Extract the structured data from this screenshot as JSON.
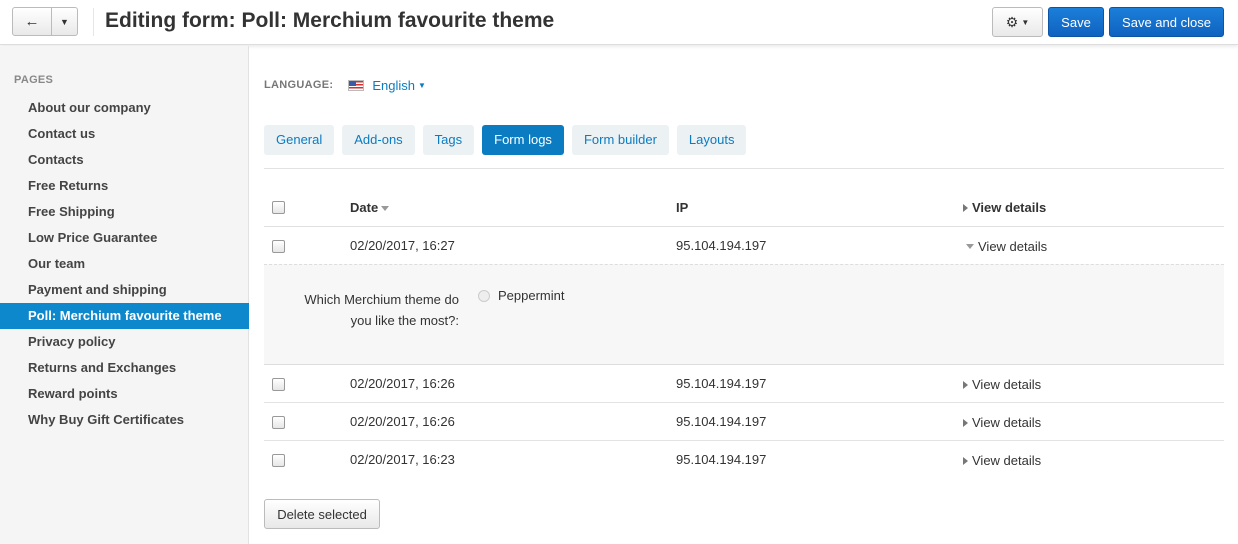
{
  "header": {
    "back_icon": "arrow-left-icon",
    "back_glyph": "←",
    "caret_glyph": "▼",
    "title": "Editing form: Poll: Merchium favourite theme",
    "gear_glyph": "⚙",
    "gear_caret": "▼",
    "save_label": "Save",
    "save_close_label": "Save and close"
  },
  "sidebar": {
    "heading": "PAGES",
    "items": [
      {
        "label": "About our company"
      },
      {
        "label": "Contact us"
      },
      {
        "label": "Contacts"
      },
      {
        "label": "Free Returns"
      },
      {
        "label": "Free Shipping"
      },
      {
        "label": "Low Price Guarantee"
      },
      {
        "label": "Our team"
      },
      {
        "label": "Payment and shipping"
      },
      {
        "label": "Poll: Merchium favourite theme",
        "active": true
      },
      {
        "label": "Privacy policy"
      },
      {
        "label": "Returns and Exchanges"
      },
      {
        "label": "Reward points"
      },
      {
        "label": "Why Buy Gift Certificates"
      }
    ]
  },
  "language": {
    "label": "LANGUAGE:",
    "value": "English",
    "flag_icon": "us-flag-icon"
  },
  "tabs": [
    {
      "label": "General"
    },
    {
      "label": "Add-ons"
    },
    {
      "label": "Tags"
    },
    {
      "label": "Form logs",
      "active": true
    },
    {
      "label": "Form builder"
    },
    {
      "label": "Layouts"
    }
  ],
  "table": {
    "columns": {
      "date": "Date",
      "ip": "IP",
      "view": "View details"
    },
    "rows": [
      {
        "date": "02/20/2017, 16:27",
        "ip": "95.104.194.197",
        "view": "View details",
        "expanded": true
      },
      {
        "date": "02/20/2017, 16:26",
        "ip": "95.104.194.197",
        "view": "View details"
      },
      {
        "date": "02/20/2017, 16:26",
        "ip": "95.104.194.197",
        "view": "View details"
      },
      {
        "date": "02/20/2017, 16:23",
        "ip": "95.104.194.197",
        "view": "View details"
      }
    ],
    "details": {
      "question": "Which Merchium theme do you like the most?:",
      "answer": "Peppermint"
    }
  },
  "actions": {
    "delete_label": "Delete selected"
  },
  "colors": {
    "accent": "#0b7cc1",
    "primary_button": "#1b7fd9",
    "sidebar_active": "#0d88cc"
  }
}
